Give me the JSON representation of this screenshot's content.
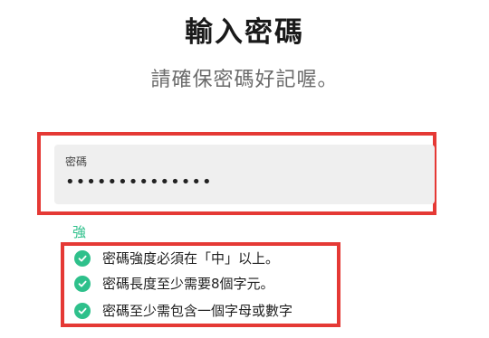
{
  "header": {
    "title": "輸入密碼",
    "subtitle": "請確保密碼好記喔。"
  },
  "password_field": {
    "label": "密碼",
    "value": "••••••••••••••"
  },
  "strength": {
    "label": "強",
    "color": "#2ec08b"
  },
  "requirements": [
    {
      "text": "密碼強度必須在「中」以上。",
      "icon": "check-circle-icon"
    },
    {
      "text": "密碼長度至少需要8個字元。",
      "icon": "check-circle-icon"
    },
    {
      "text": "密碼至少需包含一個字母或數字",
      "icon": "check-circle-icon"
    }
  ],
  "colors": {
    "highlight_border": "#e53935",
    "check": "#2ec08b"
  }
}
